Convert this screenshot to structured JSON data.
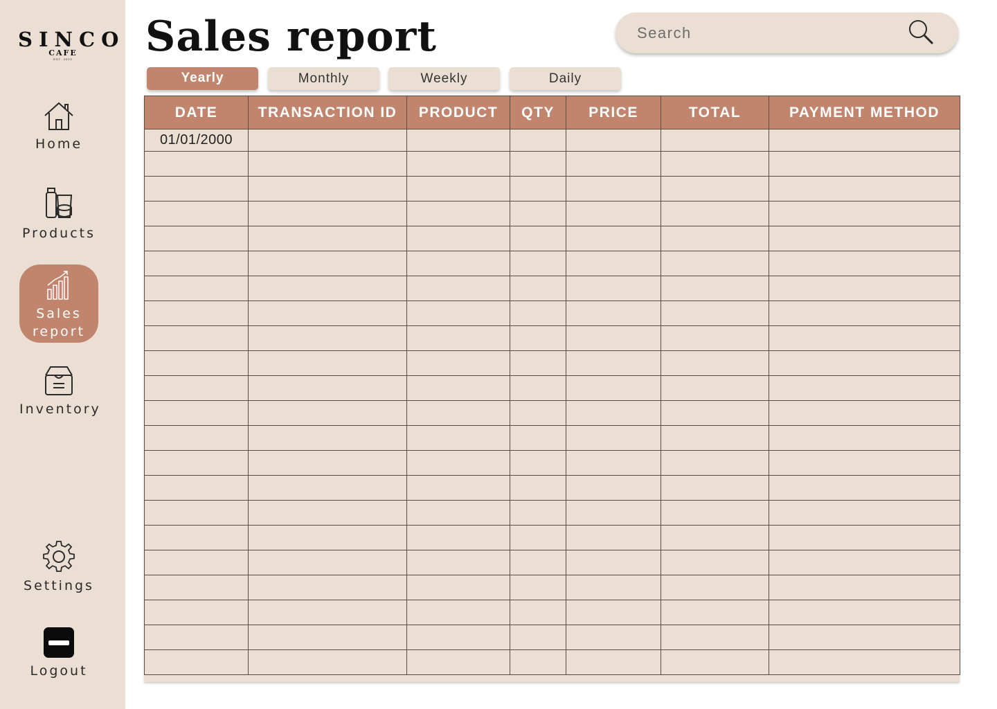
{
  "app": {
    "brand": "SINCO",
    "brand_sub": "CAFE",
    "brand_est": "EST. 2022"
  },
  "sidebar": {
    "items": [
      {
        "label": "Home",
        "icon": "home-icon"
      },
      {
        "label": "Products",
        "icon": "products-icon"
      },
      {
        "label": "Sales report",
        "icon": "bar-chart-icon",
        "active": true
      },
      {
        "label": "Inventory",
        "icon": "inventory-box-icon"
      },
      {
        "label": "Settings",
        "icon": "gear-icon"
      },
      {
        "label": "Logout",
        "icon": "logout-icon"
      }
    ]
  },
  "header": {
    "title": "Sales report"
  },
  "search": {
    "placeholder": "Search",
    "icon": "search-icon"
  },
  "tabs": [
    {
      "label": "Yearly",
      "active": true
    },
    {
      "label": "Monthly"
    },
    {
      "label": "Weekly"
    },
    {
      "label": "Daily"
    }
  ],
  "table": {
    "columns": [
      "DATE",
      "TRANSACTION ID",
      "PRODUCT",
      "QTY",
      "PRICE",
      "TOTAL",
      "PAYMENT METHOD"
    ],
    "rows": [
      [
        "01/01/2000",
        "",
        "",
        "",
        "",
        "",
        ""
      ]
    ]
  },
  "colors": {
    "accent": "#c1846c",
    "panel": "#ebdfd4",
    "text": "#111111"
  }
}
